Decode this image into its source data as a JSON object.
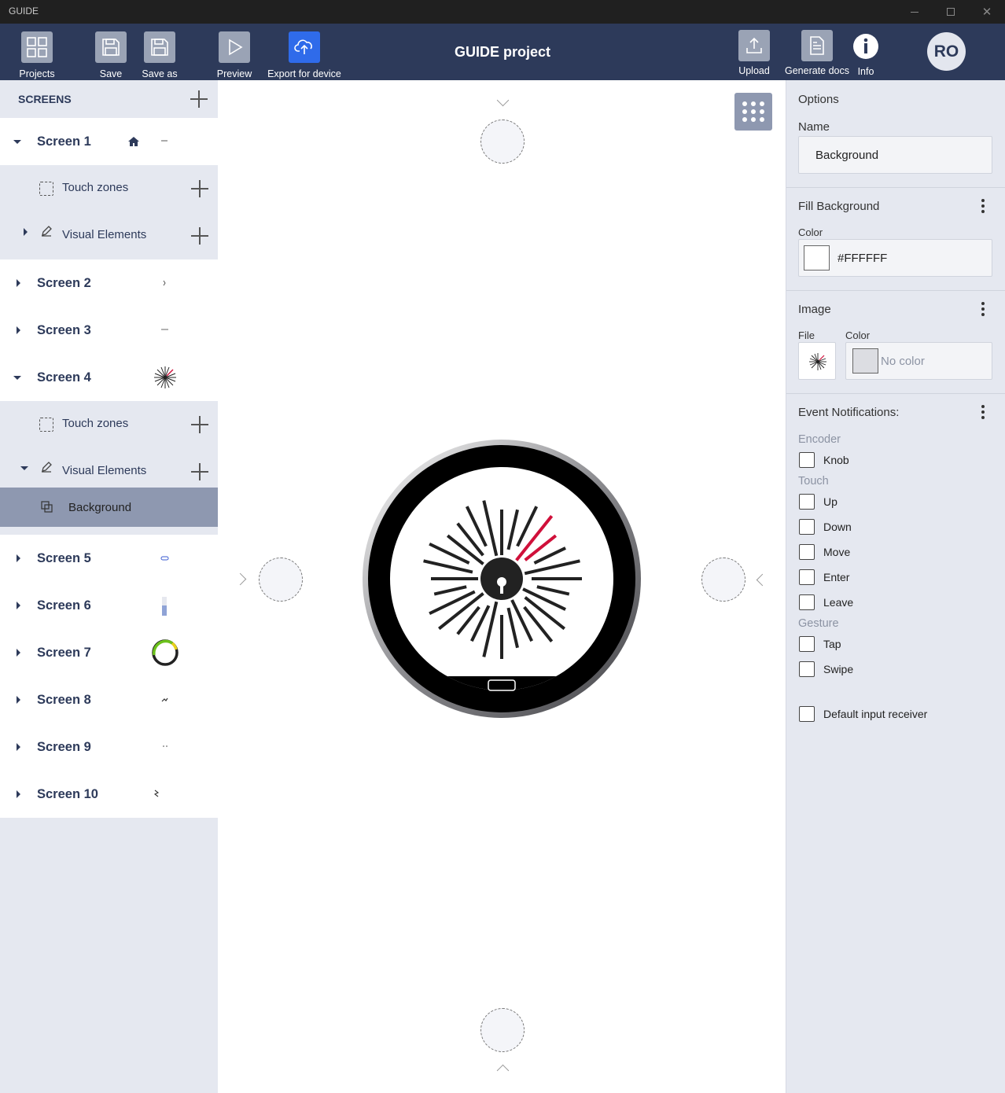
{
  "window": {
    "title": "GUIDE"
  },
  "toolbar": {
    "projects_label": "Projects",
    "save_label": "Save",
    "save_as_label": "Save as",
    "preview_label": "Preview",
    "export_label": "Export for device",
    "project_title": "GUIDE project",
    "upload_label": "Upload",
    "generate_docs_label": "Generate docs",
    "info_label": "Info",
    "avatar_initials": "RO",
    "accent_color": "#2f6bea",
    "bar_color": "#2d3a5a"
  },
  "sidebar": {
    "header": "SCREENS",
    "touch_zones_label": "Touch zones",
    "visual_elements_label": "Visual Elements",
    "screens": [
      {
        "label": "Screen 1",
        "expanded": true,
        "home": true
      },
      {
        "label": "Screen 2",
        "expanded": false
      },
      {
        "label": "Screen 3",
        "expanded": false
      },
      {
        "label": "Screen 4",
        "expanded": true
      },
      {
        "label": "Screen 5",
        "expanded": false
      },
      {
        "label": "Screen 6",
        "expanded": false
      },
      {
        "label": "Screen 7",
        "expanded": false
      },
      {
        "label": "Screen 8",
        "expanded": false
      },
      {
        "label": "Screen 9",
        "expanded": false
      },
      {
        "label": "Screen 10",
        "expanded": false
      }
    ],
    "selected_element": "Background"
  },
  "options": {
    "title": "Options",
    "name_label": "Name",
    "name_value": "Background",
    "fill_section": "Fill Background",
    "fill_color_label": "Color",
    "fill_color_value": "#FFFFFF",
    "image_section": "Image",
    "image_file_label": "File",
    "image_color_label": "Color",
    "image_color_value": "No color",
    "events_section": "Event Notifications:",
    "encoder_group": "Encoder",
    "encoder_items": [
      "Knob"
    ],
    "touch_group": "Touch",
    "touch_items": [
      "Up",
      "Down",
      "Move",
      "Enter",
      "Leave"
    ],
    "gesture_group": "Gesture",
    "gesture_items": [
      "Tap",
      "Swipe"
    ],
    "default_receiver_label": "Default input receiver"
  }
}
